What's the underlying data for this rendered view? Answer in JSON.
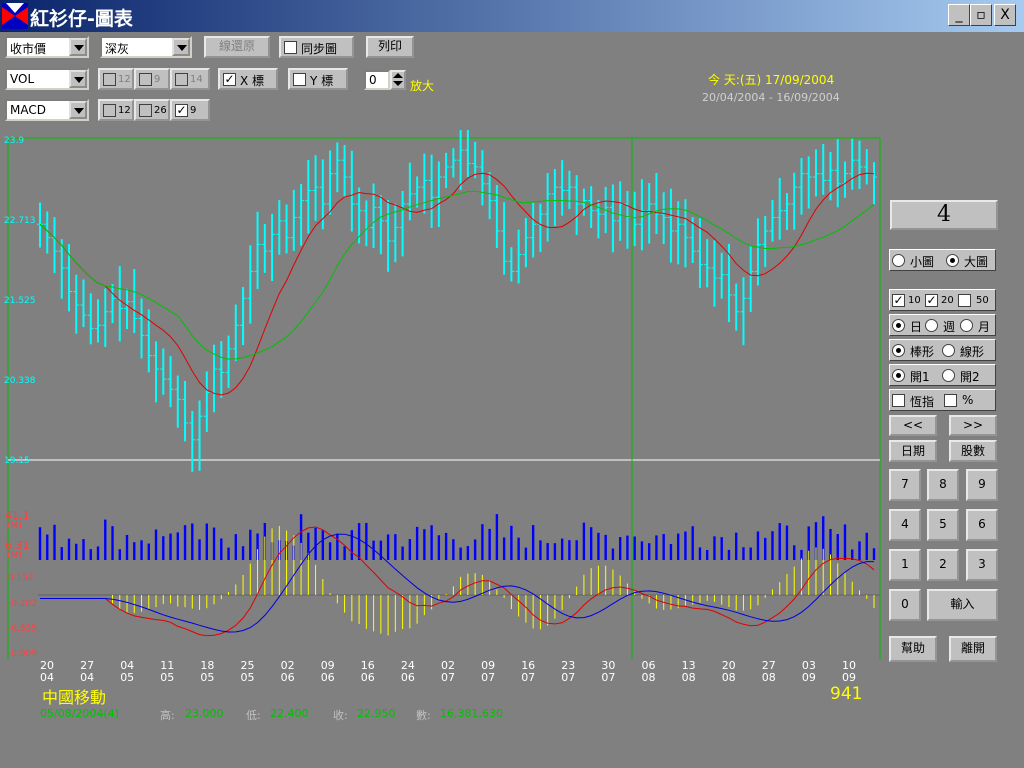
{
  "window": {
    "title": "紅衫仔-圖表",
    "controls": [
      "_",
      "▫",
      "X"
    ]
  },
  "toolbar": {
    "price_select": "收市價",
    "color_select": "深灰",
    "restore_label": "線還原",
    "sync_label": "同步圖",
    "print_label": "列印",
    "indicator1_select": "VOL",
    "vol_params": [
      "12",
      "9",
      "14"
    ],
    "x_label": "X 標",
    "y_label": "Y 標",
    "zoom_value": "0",
    "zoom_label": "放大",
    "indicator2_select": "MACD",
    "macd_params": [
      "12",
      "26",
      "9"
    ]
  },
  "info": {
    "today": "今 天:(五) 17/09/2004",
    "range": "20/04/2004 - 16/09/2004"
  },
  "side": {
    "big_value": "4",
    "size_small": "小圖",
    "size_large": "大圖",
    "ma": [
      "10",
      "20",
      "50"
    ],
    "period": [
      "日",
      "週",
      "月"
    ],
    "style": [
      "棒形",
      "線形"
    ],
    "open": [
      "開1",
      "開2"
    ],
    "misc": [
      "恆指",
      "%"
    ],
    "prev": "<<",
    "next": ">>",
    "date_btn": "日期",
    "stock_btn": "股數",
    "keys": [
      "7",
      "8",
      "9",
      "4",
      "5",
      "6",
      "1",
      "2",
      "3",
      "0"
    ],
    "enter": "輸入",
    "help": "幫助",
    "close": "離開"
  },
  "footer": {
    "stock_name": "中國移動",
    "code": "941",
    "date": "05/08/2004(4)",
    "high_label": "高:",
    "high": "23.000",
    "low_label": "低:",
    "low": "22.400",
    "close_label": "收:",
    "close": "22.950",
    "vol_label": "數:",
    "vol": "16,381,630"
  },
  "chart_data": {
    "type": "ohlc",
    "y_ticks": [
      "23.9",
      "22.713",
      "21.525",
      "20.338",
      "19.15"
    ],
    "ylim": [
      19.15,
      23.9
    ],
    "vol_labels": [
      "41.1",
      "(M)",
      "6.31",
      "(M)"
    ],
    "macd_ticks": [
      "0.152",
      "-0.202",
      "-0.555",
      "-0.909"
    ],
    "x_dates": [
      {
        "d": "20",
        "m": "04"
      },
      {
        "d": "27",
        "m": "04"
      },
      {
        "d": "04",
        "m": "05"
      },
      {
        "d": "11",
        "m": "05"
      },
      {
        "d": "18",
        "m": "05"
      },
      {
        "d": "25",
        "m": "05"
      },
      {
        "d": "02",
        "m": "06"
      },
      {
        "d": "09",
        "m": "06"
      },
      {
        "d": "16",
        "m": "06"
      },
      {
        "d": "24",
        "m": "06"
      },
      {
        "d": "02",
        "m": "07"
      },
      {
        "d": "09",
        "m": "07"
      },
      {
        "d": "16",
        "m": "07"
      },
      {
        "d": "23",
        "m": "07"
      },
      {
        "d": "30",
        "m": "07"
      },
      {
        "d": "06",
        "m": "08"
      },
      {
        "d": "13",
        "m": "08"
      },
      {
        "d": "20",
        "m": "08"
      },
      {
        "d": "27",
        "m": "08"
      },
      {
        "d": "03",
        "m": "09"
      },
      {
        "d": "10",
        "m": "09"
      }
    ],
    "close": [
      22.65,
      22.45,
      22.25,
      22.0,
      21.65,
      21.45,
      21.3,
      21.1,
      21.15,
      21.35,
      21.55,
      21.4,
      21.5,
      21.25,
      21.0,
      20.7,
      20.5,
      20.35,
      20.2,
      20.05,
      19.7,
      19.45,
      19.8,
      20.15,
      20.5,
      20.45,
      20.8,
      21.15,
      21.55,
      21.95,
      22.35,
      22.25,
      22.5,
      22.7,
      22.45,
      22.75,
      23.0,
      23.15,
      23.2,
      22.95,
      23.4,
      23.6,
      23.35,
      22.95,
      22.85,
      22.6,
      22.9,
      22.7,
      22.4,
      22.6,
      22.95,
      23.1,
      23.2,
      23.3,
      23.05,
      23.35,
      23.5,
      23.6,
      23.75,
      23.55,
      23.5,
      23.25,
      23.0,
      22.55,
      22.1,
      21.95,
      22.2,
      22.45,
      22.65,
      22.8,
      23.1,
      23.2,
      23.15,
      23.2,
      22.95,
      23.0,
      22.85,
      22.8,
      22.9,
      22.7,
      22.95,
      22.75,
      22.65,
      22.85,
      22.95,
      22.8,
      22.75,
      22.55,
      22.65,
      22.45,
      22.25,
      22.05,
      22.0,
      21.85,
      21.9,
      21.6,
      21.35,
      21.55,
      21.95,
      22.35,
      22.55,
      22.75,
      22.85,
      22.95,
      23.2,
      23.4,
      23.35,
      23.4,
      23.3,
      23.45,
      23.25,
      23.4,
      23.6,
      23.5,
      23.4,
      23.35
    ],
    "legend": {
      "ma10": "#e00000",
      "ma20": "#00c000",
      "bars": "#00ffff",
      "vol": "#0000ff",
      "dif": "#e00000",
      "dea": "#0000e0",
      "osc": "#ffff00"
    }
  }
}
